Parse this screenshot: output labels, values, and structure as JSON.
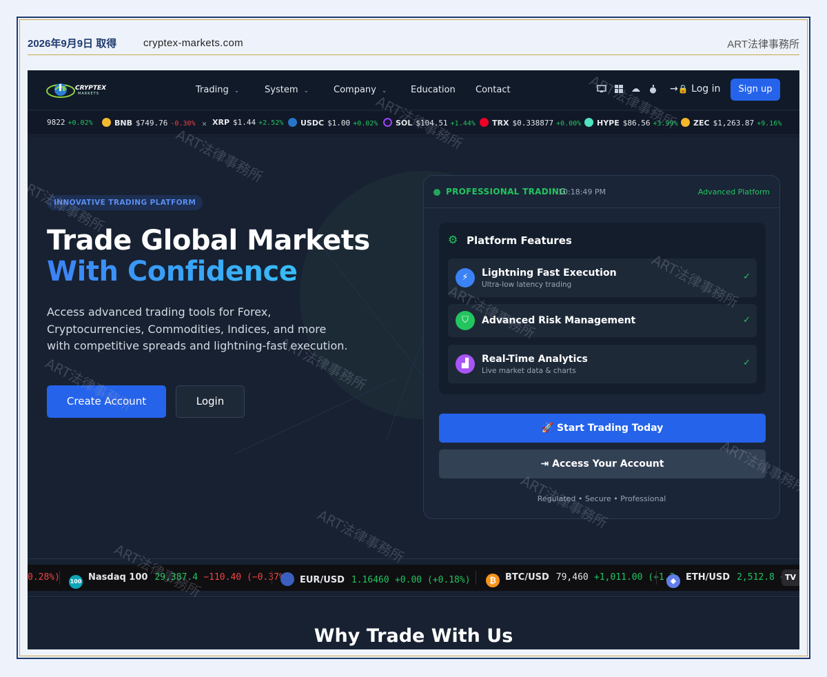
{
  "caption": {
    "date": "2026年9月9日 取得",
    "url": "cryptex-markets.com",
    "firm": "ART法律事務所"
  },
  "nav": {
    "logo_text": "CRYPTEX",
    "logo_sub": "MARKETS",
    "items": [
      {
        "label": "Trading",
        "dropdown": true
      },
      {
        "label": "System",
        "dropdown": true
      },
      {
        "label": "Company",
        "dropdown": true
      },
      {
        "label": "Education",
        "dropdown": false
      },
      {
        "label": "Contact",
        "dropdown": false
      }
    ],
    "platform_icons": [
      "desktop-icon",
      "windows-icon",
      "android-icon",
      "apple-icon"
    ],
    "login_label": "Log in",
    "signup_label": "Sign up"
  },
  "crypto_ticker": [
    {
      "symbol": "",
      "price": "9822",
      "change": "+0.02%",
      "dir": "up",
      "color": ""
    },
    {
      "symbol": "BNB",
      "price": "$749.76",
      "change": "-0.30%",
      "dir": "down",
      "color": "#f3ba2f"
    },
    {
      "symbol": "XRP",
      "price": "$1.44",
      "change": "+2.52%",
      "dir": "up",
      "color": "#9ca3af"
    },
    {
      "symbol": "USDC",
      "price": "$1.00",
      "change": "+0.02%",
      "dir": "up",
      "color": "#2775ca"
    },
    {
      "symbol": "SOL",
      "price": "$104.51",
      "change": "+1.44%",
      "dir": "up",
      "color": "#9945ff"
    },
    {
      "symbol": "TRX",
      "price": "$0.338877",
      "change": "+0.00%",
      "dir": "up",
      "color": "#ef0027"
    },
    {
      "symbol": "HYPE",
      "price": "$86.56",
      "change": "+3.99%",
      "dir": "up",
      "color": "#50e3c2"
    },
    {
      "symbol": "ZEC",
      "price": "$1,263.87",
      "change": "+9.16%",
      "dir": "up",
      "color": "#f4b728"
    }
  ],
  "hero": {
    "badge": "INNOVATIVE TRADING PLATFORM",
    "title_line1": "Trade Global Markets",
    "title_line2": "With Confidence",
    "description": "Access advanced trading tools for Forex, Cryptocurrencies, Commodities, Indices, and more with competitive spreads and lightning-fast execution.",
    "create_account": "Create Account",
    "login": "Login"
  },
  "panel": {
    "status": "PROFESSIONAL TRADING",
    "time": "10:18:49 PM",
    "tag": "Advanced Platform",
    "features_title": "Platform Features",
    "features": [
      {
        "title": "Lightning Fast Execution",
        "subtitle": "Ultra-low latency trading",
        "icon": "bolt-icon",
        "color": "#3b82f6"
      },
      {
        "title": "Advanced Risk Management",
        "subtitle": "",
        "icon": "shield-icon",
        "color": "#22c55e"
      },
      {
        "title": "Real-Time Analytics",
        "subtitle": "Live market data & charts",
        "icon": "chart-icon",
        "color": "#a855f7"
      }
    ],
    "start_trading": "Start Trading Today",
    "access_account": "Access Your Account",
    "footer": "Regulated • Secure • Professional"
  },
  "market_ticker": [
    {
      "name": "",
      "price": "",
      "change": "0.28%)",
      "dir": "down"
    },
    {
      "name": "Nasdaq 100",
      "price": "29,387.4",
      "change": "−110.40 (−0.37%)",
      "dir": "down",
      "logo": "100",
      "color": "#0ea5b7"
    },
    {
      "name": "EUR/USD",
      "price": "1.16460",
      "change": "+0.00 (+0.18%)",
      "dir": "up",
      "logo": "",
      "color": "#3b5fc0"
    },
    {
      "name": "BTC/USD",
      "price": "79,460",
      "change": "+1,011.00 (+1.2",
      "dir": "up",
      "logo": "₿",
      "color": "#f7931a"
    },
    {
      "name": "ETH/USD",
      "price": "2,512.8",
      "change": "+2",
      "dir": "up",
      "logo": "◆",
      "color": "#627eea"
    }
  ],
  "tv_logo": "TV",
  "why_title": "Why Trade With Us",
  "watermark": "ART法律事務所"
}
